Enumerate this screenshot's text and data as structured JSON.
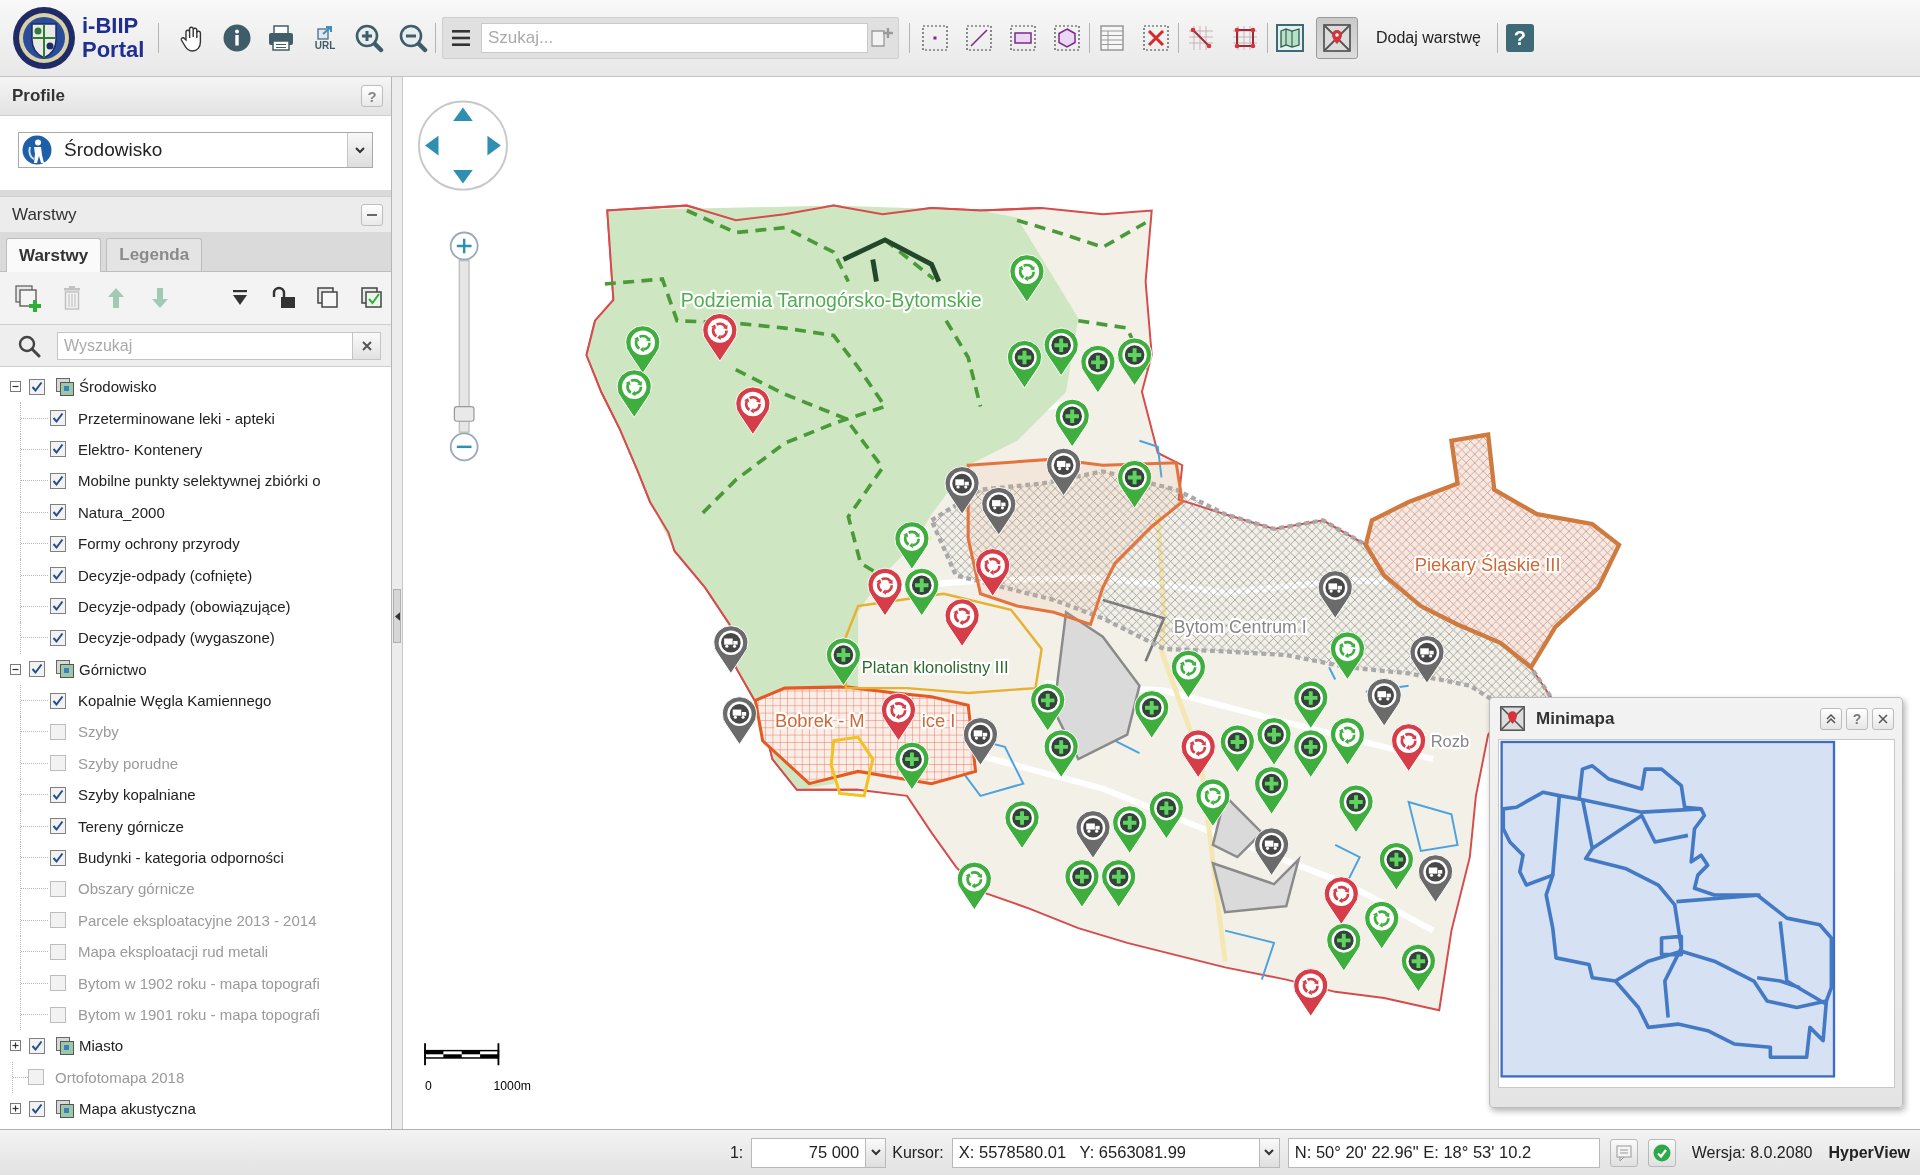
{
  "toolbar": {
    "logo": {
      "line1": "i-BIIP",
      "line2": "Portal"
    },
    "url_button": "URL",
    "search": {
      "placeholder": "Szukaj..."
    },
    "minimap_toggle": {
      "on": true
    },
    "add_layer_button": "Dodaj warstwę",
    "help_button": "?"
  },
  "profile_panel": {
    "title": "Profile",
    "help_button": "?",
    "profile": {
      "value": "Środowisko"
    }
  },
  "layers_panel": {
    "title": "Warstwy",
    "tabs": [
      {
        "label": "Warstwy",
        "selected": true
      },
      {
        "label": "Legenda",
        "selected": false
      }
    ],
    "tools": {
      "delete": {
        "disabled": true
      },
      "move_up": {
        "disabled": true
      },
      "move_down": {
        "disabled": true
      }
    },
    "search": {
      "placeholder": "Wyszukaj"
    },
    "tree": [
      {
        "kind": "group",
        "label": "Środowisko",
        "checked": true,
        "expanded": true,
        "children": [
          {
            "kind": "layer",
            "label": "Przeterminowane leki - apteki",
            "checked": true
          },
          {
            "kind": "layer",
            "label": "Elektro- Kontenery",
            "checked": true
          },
          {
            "kind": "layer",
            "label": "Mobilne punkty selektywnej zbiórki o",
            "checked": true
          },
          {
            "kind": "layer",
            "label": "Natura_2000",
            "checked": true
          },
          {
            "kind": "layer",
            "label": "Formy ochrony przyrody",
            "checked": true
          },
          {
            "kind": "layer",
            "label": "Decyzje-odpady (cofnięte)",
            "checked": true
          },
          {
            "kind": "layer",
            "label": "Decyzje-odpady (obowiązujące)",
            "checked": true
          },
          {
            "kind": "layer",
            "label": "Decyzje-odpady (wygaszone)",
            "checked": true
          }
        ]
      },
      {
        "kind": "group",
        "label": "Górnictwo",
        "checked": true,
        "expanded": true,
        "children": [
          {
            "kind": "layer",
            "label": "Kopalnie Węgla Kamiennego",
            "checked": true
          },
          {
            "kind": "layer",
            "label": "Szyby",
            "checked": false
          },
          {
            "kind": "layer",
            "label": "Szyby porudne",
            "checked": false
          },
          {
            "kind": "layer",
            "label": "Szyby kopalniane",
            "checked": true
          },
          {
            "kind": "layer",
            "label": "Tereny górnicze",
            "checked": true
          },
          {
            "kind": "layer",
            "label": "Budynki - kategoria odporności",
            "checked": true
          },
          {
            "kind": "layer",
            "label": "Obszary górnicze",
            "checked": false
          },
          {
            "kind": "layer",
            "label": "Parcele eksploatacyjne 2013 - 2014",
            "checked": false
          },
          {
            "kind": "layer",
            "label": "Mapa eksploatacji rud metali",
            "checked": false
          },
          {
            "kind": "layer",
            "label": "Bytom w 1902 roku - mapa topografi",
            "checked": false
          },
          {
            "kind": "layer",
            "label": "Bytom w 1901 roku - mapa topografi",
            "checked": false
          }
        ]
      },
      {
        "kind": "group",
        "label": "Miasto",
        "checked": true,
        "expanded": false
      },
      {
        "kind": "layer",
        "label": "Ortofotomapa 2018",
        "checked": false
      },
      {
        "kind": "group",
        "label": "Mapa akustyczna",
        "checked": true,
        "expanded": false
      }
    ]
  },
  "map": {
    "labels": [
      {
        "text": "Podziemia Tarnogórsko-Bytomskie",
        "kind": "nature"
      },
      {
        "text": "Platan klonolistny III",
        "kind": "monument"
      },
      {
        "text": "Bobrek - M",
        "kind": "mining"
      },
      {
        "text": "ice I",
        "kind": "mining"
      },
      {
        "text": "Bytom Centrum I",
        "kind": "district"
      },
      {
        "text": "Piekary Śląskie III",
        "kind": "mining"
      },
      {
        "text": "Rozb",
        "kind": "district"
      }
    ],
    "zoom_slider": {
      "level": 0.1
    },
    "scale_bar": {
      "start": "0",
      "end": "1000m"
    }
  },
  "minimap": {
    "title": "Minimapa",
    "help_button": "?"
  },
  "status_bar": {
    "scale_label": "1:",
    "scale": "75 000",
    "cursor_label": "Kursor:",
    "coordinates": "X: 5578580.01   Y: 6563081.99",
    "geo_coordinates": "N: 50° 20' 22.96\" E: 18° 53' 10.2",
    "version": "Wersja: 8.0.2080",
    "brand": "HyperView"
  }
}
